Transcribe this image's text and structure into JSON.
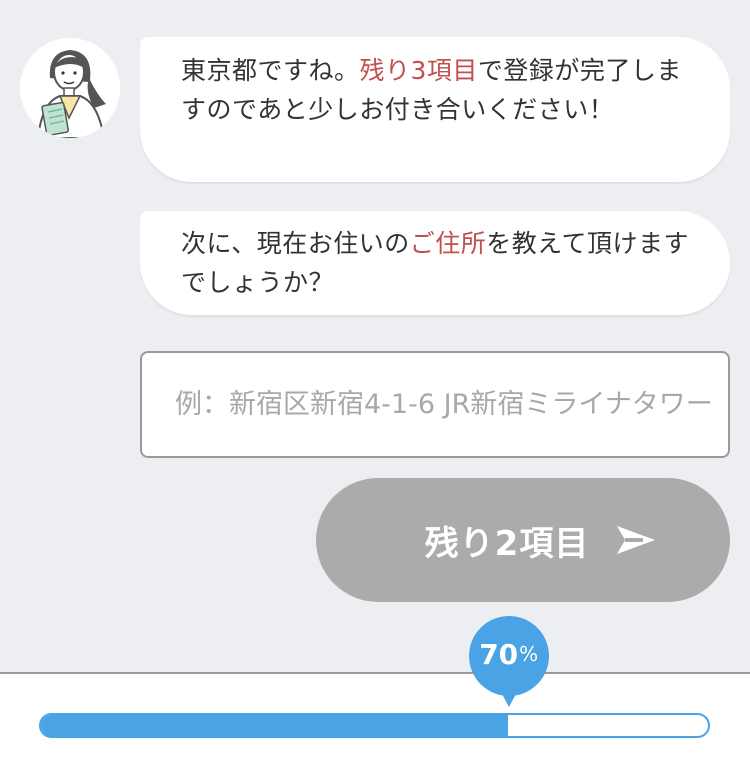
{
  "chat": {
    "messages": [
      {
        "before": "東京都ですね。",
        "highlight": "残り3項目",
        "after": "で登録が完了しますのであと少しお付き合いください！"
      },
      {
        "before": "次に、現在お住いの",
        "highlight": "ご住所",
        "after": "を教えて頂けますでしょうか？"
      }
    ]
  },
  "form": {
    "address_placeholder": "例：新宿区新宿4-1-6 JR新宿ミライナタワー",
    "address_value": ""
  },
  "submit": {
    "label": "残り2項目",
    "icon": "send-arrow-icon"
  },
  "progress": {
    "percent": 70,
    "value_text": "70",
    "unit": "%"
  },
  "colors": {
    "highlight": "#c0504d",
    "accent": "#4aa3e4",
    "button_disabled": "#ababab",
    "background": "#eceef1"
  }
}
